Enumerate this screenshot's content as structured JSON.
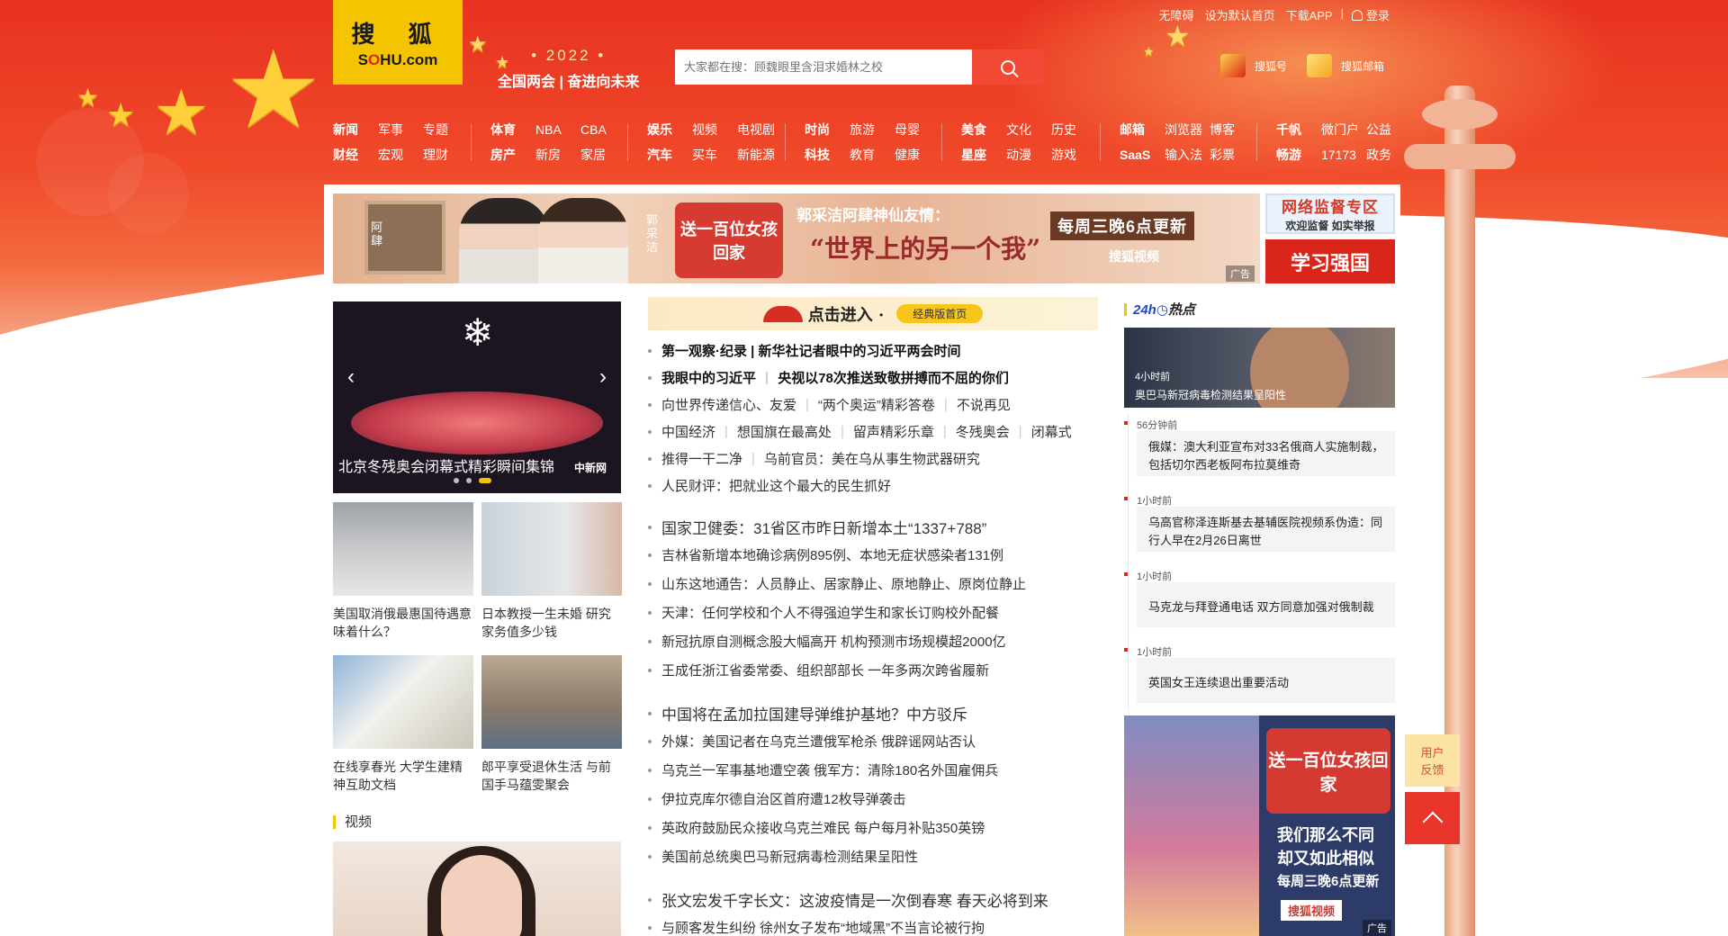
{
  "topbar": {
    "links": [
      "无障碍",
      "设为默认首页",
      "下载APP"
    ],
    "login": "登录"
  },
  "logo": {
    "cn": "搜  狐",
    "en_pre": "S",
    "en_mid": "O",
    "en_post": "HU.com"
  },
  "slogan": {
    "year": "• 2022 •",
    "text": "全国两会 | 奋进向未来"
  },
  "search": {
    "placeholder": "大家都在搜：顾魏眼里含泪求婚林之校"
  },
  "quicklinks": [
    "搜狐号",
    "搜狐邮箱"
  ],
  "nav": [
    {
      "rows": [
        [
          "新闻",
          "军事",
          "专题"
        ],
        [
          "财经",
          "宏观",
          "理财"
        ]
      ]
    },
    {
      "rows": [
        [
          "体育",
          "NBA",
          "CBA"
        ],
        [
          "房产",
          "新房",
          "家居"
        ]
      ]
    },
    {
      "rows": [
        [
          "娱乐",
          "视频",
          "电视剧"
        ],
        [
          "汽车",
          "买车",
          "新能源"
        ]
      ]
    },
    {
      "rows": [
        [
          "时尚",
          "旅游",
          "母婴"
        ],
        [
          "科技",
          "教育",
          "健康"
        ]
      ]
    },
    {
      "rows": [
        [
          "美食",
          "文化",
          "历史"
        ],
        [
          "星座",
          "动漫",
          "游戏"
        ]
      ]
    },
    {
      "rows": [
        [
          "邮箱",
          "浏览器",
          "博客"
        ],
        [
          "SaaS",
          "输入法",
          "彩票"
        ]
      ]
    },
    {
      "rows": [
        [
          "千帆",
          "微门户",
          "公益"
        ],
        [
          "畅游",
          "17173",
          "政务"
        ]
      ]
    }
  ],
  "banner": {
    "left_name_1": "阿肆",
    "left_name_2": "郭采洁",
    "badge": "送一百位女孩回家",
    "headline": "郭采洁阿肆神仙友情：",
    "quote": "“世界上的另一个我”",
    "schedule": "每周三晚6点更新",
    "brand": "搜狐视频",
    "ad_label": "广告"
  },
  "side_ads": {
    "box1_title": "网络监督专区",
    "box1_sub": "欢迎监督  如实举报",
    "box2_title": "学习强国"
  },
  "carousel": {
    "caption": "北京冬残奥会闭幕式精彩瞬间集锦",
    "prev": "‹",
    "next": "›",
    "watermark": "中新网"
  },
  "thumbs": [
    {
      "caption": "美国取消俄最惠国待遇意味着什么？"
    },
    {
      "caption": "日本教授一生未婚 研究家务值多少钱"
    },
    {
      "caption": "在线享春光 大学生建精神互助文档"
    },
    {
      "caption": "郎平享受退休生活 与前国手马蕴雯聚会"
    }
  ],
  "video_section": {
    "title": "视频"
  },
  "classic": {
    "enter": "点击进入 ·",
    "button": "经典版首页"
  },
  "news_top": [
    {
      "items": [
        "第一观察·纪录 | 新华社记者眼中的习近平两会时间"
      ],
      "bold": true
    },
    {
      "items": [
        "我眼中的习近平",
        "央视以78次推送致敬拼搏而不屈的你们"
      ],
      "bold": true
    },
    {
      "items": [
        "向世界传递信心、友爱",
        "“两个奥运”精彩答卷",
        "不说再见"
      ]
    },
    {
      "items": [
        "中国经济",
        "想国旗在最高处",
        "留声精彩乐章",
        "冬残奥会",
        "闭幕式"
      ]
    },
    {
      "items": [
        "推得一干二净",
        "乌前官员：美在乌从事生物武器研究"
      ]
    },
    {
      "items": [
        "人民财评：把就业这个最大的民生抓好"
      ]
    }
  ],
  "news_block1": {
    "headline": "国家卫健委：31省区市昨日新增本土“1337+788”",
    "items": [
      "吉林省新增本地确诊病例895例、本地无症状感染者131例",
      "山东这地通告：人员静止、居家静止、原地静止、原岗位静止",
      "天津：任何学校和个人不得强迫学生和家长订购校外配餐",
      "新冠抗原自测概念股大幅高开 机构预测市场规模超2000亿",
      "王成任浙江省委常委、组织部部长 一年多两次跨省履新"
    ]
  },
  "news_block2": {
    "headline": "中国将在孟加拉国建导弹维护基地？中方驳斥",
    "items": [
      "外媒：美国记者在乌克兰遭俄军枪杀 俄辟谣网站否认",
      "乌克兰一军事基地遭空袭 俄军方：清除180名外国雇佣兵",
      "伊拉克库尔德自治区首府遭12枚导弹袭击",
      "英政府鼓励民众接收乌克兰难民 每户每月补贴350英镑",
      "美国前总统奥巴马新冠病毒检测结果呈阳性"
    ]
  },
  "news_block3": {
    "headline": "张文宏发千字长文：这波疫情是一次倒春寒 春天必将到来",
    "items": [
      "与顾客发生纠纷 徐州女子发布“地域黑”不当言论被行拘"
    ]
  },
  "hot": {
    "title_prefix": "24h",
    "title_suffix": "热点",
    "top": {
      "time": "4小时前",
      "title": "奥巴马新冠病毒检测结果呈阳性"
    },
    "items": [
      {
        "time": "56分钟前",
        "title": "俄媒：澳大利亚宣布对33名俄商人实施制裁，包括切尔西老板阿布拉莫维奇"
      },
      {
        "time": "1小时前",
        "title": "乌高官称泽连斯基去基辅医院视频系伪造：同行人早在2月26日离世"
      },
      {
        "time": "1小时前",
        "title": "马克龙与拜登通电话 双方同意加强对俄制裁"
      },
      {
        "time": "1小时前",
        "title": "英国女王连续退出重要活动"
      }
    ]
  },
  "right_ad": {
    "badge": "送一百位女孩回家",
    "line1": "我们那么不同",
    "line2": "却又如此相似",
    "line3": "每周三晚6点更新",
    "brand": "搜狐视频",
    "ad_label": "广告"
  },
  "floating": {
    "feedback_1": "用户",
    "feedback_2": "反馈"
  }
}
